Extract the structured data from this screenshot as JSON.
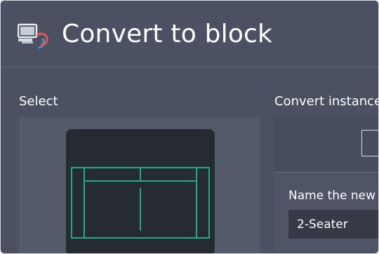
{
  "dialog": {
    "title": "Convert to block",
    "icon": "convert-block-icon"
  },
  "select_section": {
    "label": "Select"
  },
  "convert_section": {
    "label": "Convert instance",
    "name_label": "Name the new",
    "name_value": "2-Seater"
  },
  "colors": {
    "background": "#4b5162",
    "canvas": "#262b33",
    "sofa_stroke": "#1fae84",
    "icon_accent": "#e0574f",
    "icon_blue": "#4a90e2"
  }
}
